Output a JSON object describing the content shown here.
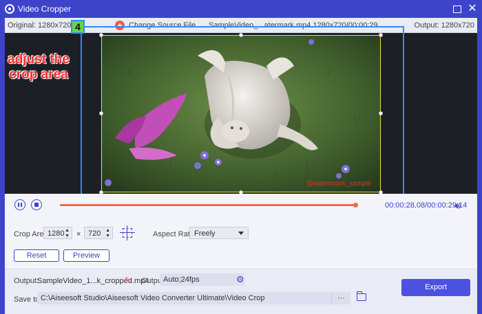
{
  "window": {
    "title": "Video Cropper"
  },
  "infobar": {
    "original": "Original: 1280x720",
    "change_source": "Change Source File",
    "file_info": "SampleVideo_...atermark.mp4     1280x720/00:00:29",
    "output": "Output: 1280x720"
  },
  "video": {
    "watermark": "@watermark_sample"
  },
  "annotation": {
    "step_number": "4",
    "callout_text": "adjust the crop area"
  },
  "playback": {
    "time": "00:00:28.08/00:00:29.14",
    "progress": 0.96
  },
  "crop": {
    "label": "Crop Area:",
    "width": "1280",
    "times_sign": "×",
    "height": "720",
    "aspect_label": "Aspect Ratio:",
    "aspect_value": "Freely",
    "reset_label": "Reset",
    "preview_label": "Preview"
  },
  "output": {
    "label": "Output:",
    "filename": "SampleVideo_1...k_cropped.mp4",
    "format_label": "Output:",
    "format_value": "Auto;24fps",
    "saveto_label": "Save to:",
    "path": "C:\\Aiseesoft Studio\\Aiseesoft Video Converter Ultimate\\Video Crop",
    "browse_label": "···",
    "export_label": "Export"
  },
  "colors": {
    "accent": "#3e44c9",
    "annotation_blue": "#2e8ef0",
    "crop_frame": "#e8e640",
    "callout_red": "#ff2b2b"
  }
}
